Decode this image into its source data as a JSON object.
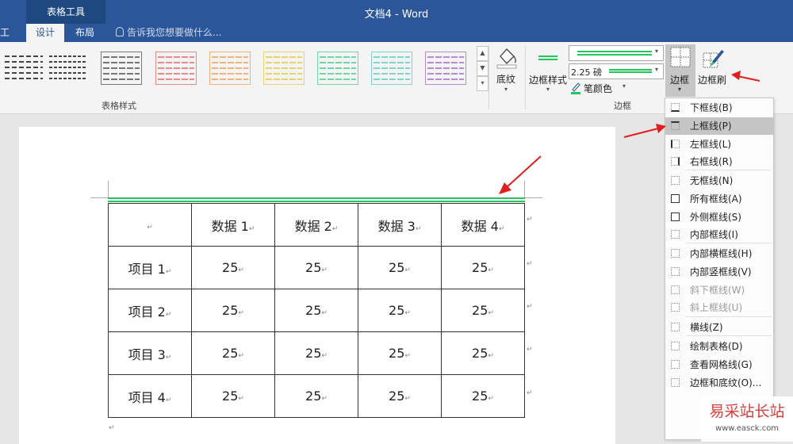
{
  "window": {
    "title": "文档4 - Word",
    "context_group": "表格工具",
    "cut_tab": "工具"
  },
  "tabs": [
    {
      "label": "设计"
    },
    {
      "label": "布局"
    }
  ],
  "tellme": {
    "text": "告诉我您想要做什么..."
  },
  "ribbon": {
    "table_styles_label": "表格样式",
    "shading_label": "底纹",
    "border_styles_label": "边框样式",
    "pen_weight": "2.25 磅",
    "pen_color_label": "笔颜色",
    "borders_group_label": "边框",
    "borders_btn_label": "边框",
    "border_painter_label": "边框刷"
  },
  "style_colors": [
    "#444444",
    "#444444",
    "#777777",
    "#e88b8b",
    "#f2b37a",
    "#e8d36a",
    "#6fd6a6",
    "#7fd4cc",
    "#b58bd6"
  ],
  "colors": {
    "accent": "#2b579a",
    "pen_green": "#22c55e",
    "arrow_red": "#e02020"
  },
  "table": {
    "header": [
      "",
      "数据 1",
      "数据 2",
      "数据 3",
      "数据 4"
    ],
    "rows": [
      [
        "项目 1",
        "25",
        "25",
        "25",
        "25"
      ],
      [
        "项目 2",
        "25",
        "25",
        "25",
        "25"
      ],
      [
        "项目 3",
        "25",
        "25",
        "25",
        "25"
      ],
      [
        "项目 4",
        "25",
        "25",
        "25",
        "25"
      ]
    ]
  },
  "dropdown": [
    {
      "label": "下框线(B)",
      "icon": "bottom-border-icon"
    },
    {
      "label": "上框线(P)",
      "icon": "top-border-icon",
      "highlighted": true
    },
    {
      "label": "左框线(L)",
      "icon": "left-border-icon"
    },
    {
      "label": "右框线(R)",
      "icon": "right-border-icon"
    },
    {
      "label": "无框线(N)",
      "icon": "no-border-icon"
    },
    {
      "label": "所有框线(A)",
      "icon": "all-borders-icon"
    },
    {
      "label": "外侧框线(S)",
      "icon": "outside-borders-icon"
    },
    {
      "label": "内部框线(I)",
      "icon": "inside-borders-icon"
    },
    {
      "label": "内部横框线(H)",
      "icon": "inside-horizontal-border-icon"
    },
    {
      "label": "内部竖框线(V)",
      "icon": "inside-vertical-border-icon"
    },
    {
      "label": "斜下框线(W)",
      "icon": "diagonal-down-border-icon",
      "disabled": true
    },
    {
      "label": "斜上框线(U)",
      "icon": "diagonal-up-border-icon",
      "disabled": true
    },
    {
      "label": "横线(Z)",
      "icon": "horizontal-line-icon"
    },
    {
      "label": "绘制表格(D)",
      "icon": "draw-table-icon"
    },
    {
      "label": "查看网格线(G)",
      "icon": "view-gridlines-icon"
    },
    {
      "label": "边框和底纹(O)...",
      "icon": "borders-shading-icon"
    }
  ],
  "watermark": {
    "title": "易采站长站",
    "url": "www.easck.com"
  }
}
